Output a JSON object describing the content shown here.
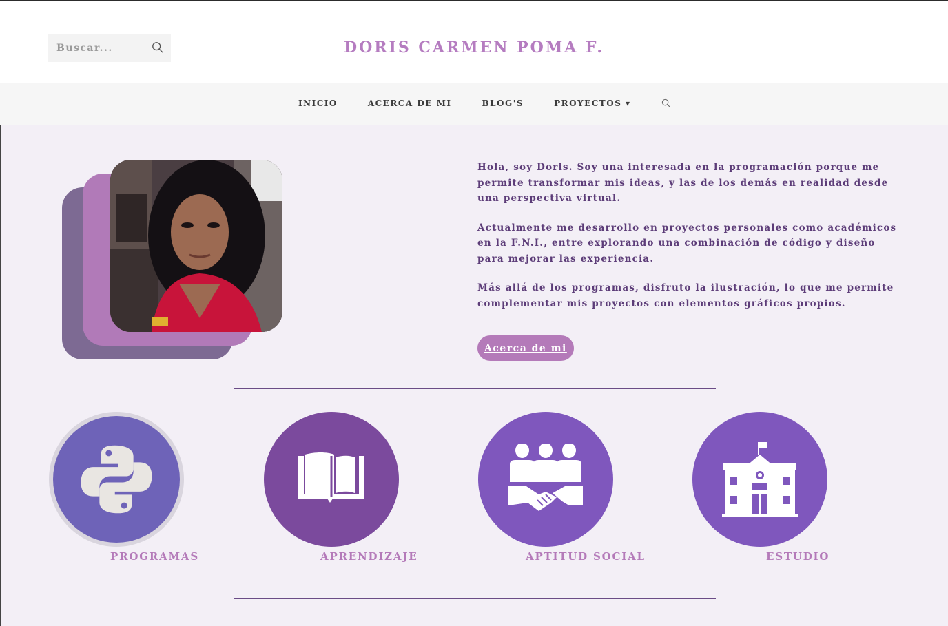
{
  "header": {
    "search_placeholder": "Buscar...",
    "site_title": "DORIS CARMEN POMA F."
  },
  "nav": {
    "items": [
      {
        "label": "INICIO"
      },
      {
        "label": "ACERCA DE MI"
      },
      {
        "label": "BLOG'S"
      },
      {
        "label": "PROYECTOS ▾"
      }
    ]
  },
  "intro": {
    "paragraphs": [
      "Hola, soy Doris. Soy una interesada en la programación porque me permite transformar mis ideas, y las de los demás en realidad desde una perspectiva virtual.",
      "Actualmente me desarrollo en proyectos personales como académicos en la F.N.I., entre explorando una combinación de código y diseño para mejorar las experiencia.",
      "Más allá de los programas, disfruto la ilustración, lo que me permite complementar mis proyectos con elementos gráficos propios."
    ],
    "button_label": "Acerca de mi"
  },
  "features": [
    {
      "label": "PROGRAMAS",
      "icon": "python-icon",
      "color": "#6e63b8"
    },
    {
      "label": "APRENDIZAJE",
      "icon": "book-icon",
      "color": "#7b4a9d"
    },
    {
      "label": "APTITUD SOCIAL",
      "icon": "teamwork-handshake-icon",
      "color": "#7f57bd"
    },
    {
      "label": "ESTUDIO",
      "icon": "school-building-icon",
      "color": "#7f57bd"
    }
  ],
  "colors": {
    "accent": "#b47ab9",
    "text": "#5c3c78",
    "background": "#f3eff6"
  }
}
